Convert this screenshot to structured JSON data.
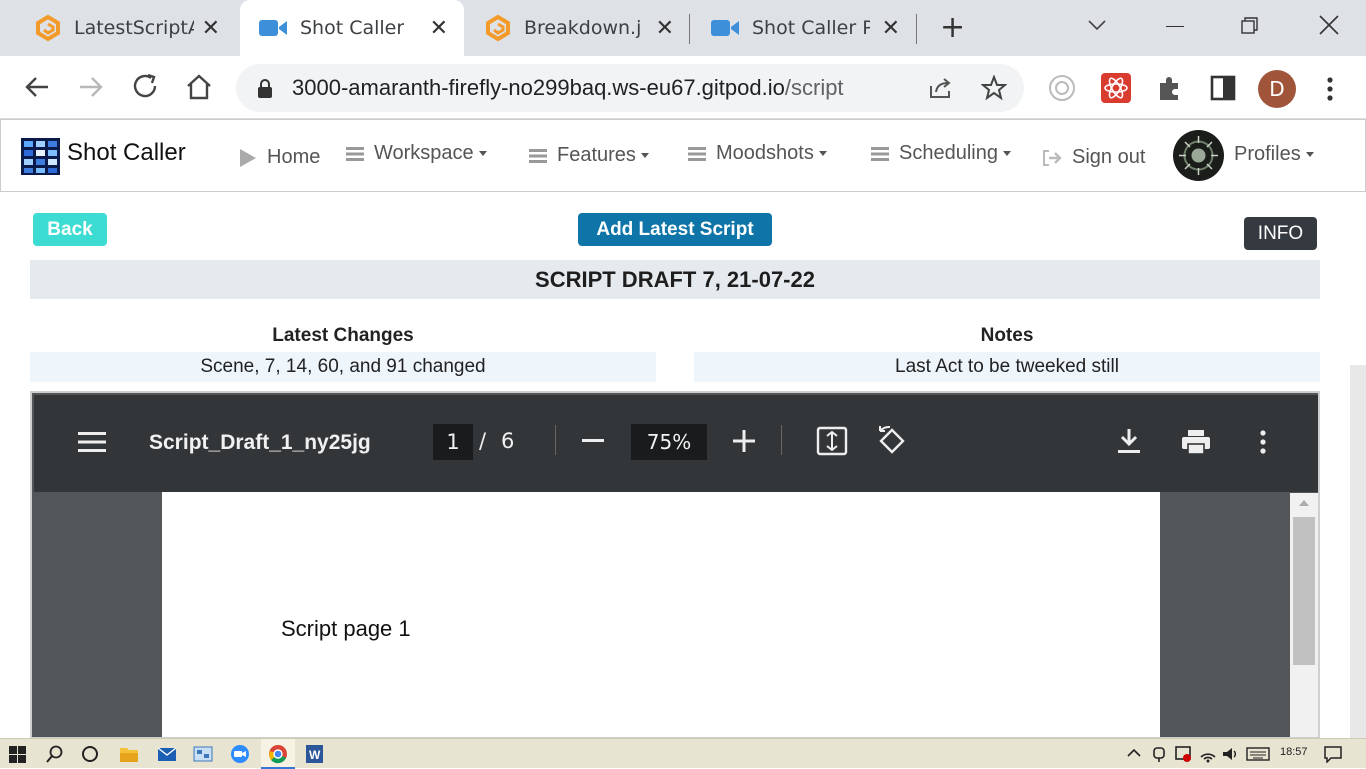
{
  "browser": {
    "tabs": [
      {
        "title": "LatestScriptA",
        "icon": "gitpod-icon"
      },
      {
        "title": "Shot Caller",
        "icon": "video-icon",
        "active": true
      },
      {
        "title": "Breakdown.js",
        "icon": "gitpod-icon"
      },
      {
        "title": "Shot Caller Pr",
        "icon": "video-icon"
      }
    ],
    "new_tab": "+",
    "url_host": "3000-amaranth-firefly-no299baq.ws-eu67.gitpod.io",
    "url_path": "/script",
    "profile_initial": "D"
  },
  "app": {
    "brand": "Shot Caller",
    "nav": {
      "home": "Home",
      "workspace": "Workspace",
      "features": "Features",
      "moodshots": "Moodshots",
      "scheduling": "Scheduling",
      "signout": "Sign out",
      "profiles": "Profiles"
    }
  },
  "page": {
    "back_label": "Back",
    "add_label": "Add Latest Script",
    "info_label": "INFO",
    "draft_title": "SCRIPT DRAFT 7, 21-07-22",
    "changes_heading": "Latest Changes",
    "changes_text": "Scene, 7, 14, 60, and 91 changed",
    "notes_heading": "Notes",
    "notes_text": "Last Act to be tweeked still",
    "colors": {
      "back": "#3ddcd3",
      "add": "#0f75a8",
      "info": "#343a40"
    }
  },
  "pdf": {
    "filename": "Script_Draft_1_ny25jg",
    "current_page": "1",
    "separator": "/",
    "total_pages": "6",
    "zoom": "75%",
    "page_text": "Script page 1"
  },
  "taskbar": {
    "time": "18:57"
  }
}
